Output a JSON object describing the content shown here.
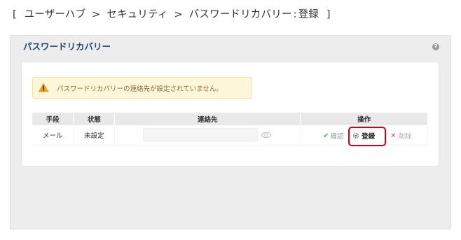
{
  "breadcrumb": {
    "open": "[",
    "items": [
      "ユーザーハブ",
      "セキュリティ",
      "パスワードリカバリー"
    ],
    "sep": ">",
    "current": "登録",
    "current_sep": ":",
    "close": "]"
  },
  "panel": {
    "title": "パスワードリカバリー",
    "help_icon": "question-circle-icon"
  },
  "alert": {
    "icon": "warning-triangle-icon",
    "text": "パスワードリカバリーの連絡先が設定されていません。"
  },
  "table": {
    "headers": [
      "手段",
      "状態",
      "連絡先",
      "操作"
    ],
    "rows": [
      {
        "method": "メール",
        "status": "未設定",
        "contact_value": "",
        "eye_icon": "eye-icon",
        "actions": {
          "confirm": "確認",
          "register": "登録",
          "delete": "削除"
        }
      }
    ]
  },
  "colors": {
    "title": "#24486f",
    "alert_bg": "#fdf6d8",
    "alert_text": "#8a6d3b",
    "confirm_check": "#4caf50",
    "delete_x": "#e05050",
    "highlight": "#d0021b"
  }
}
